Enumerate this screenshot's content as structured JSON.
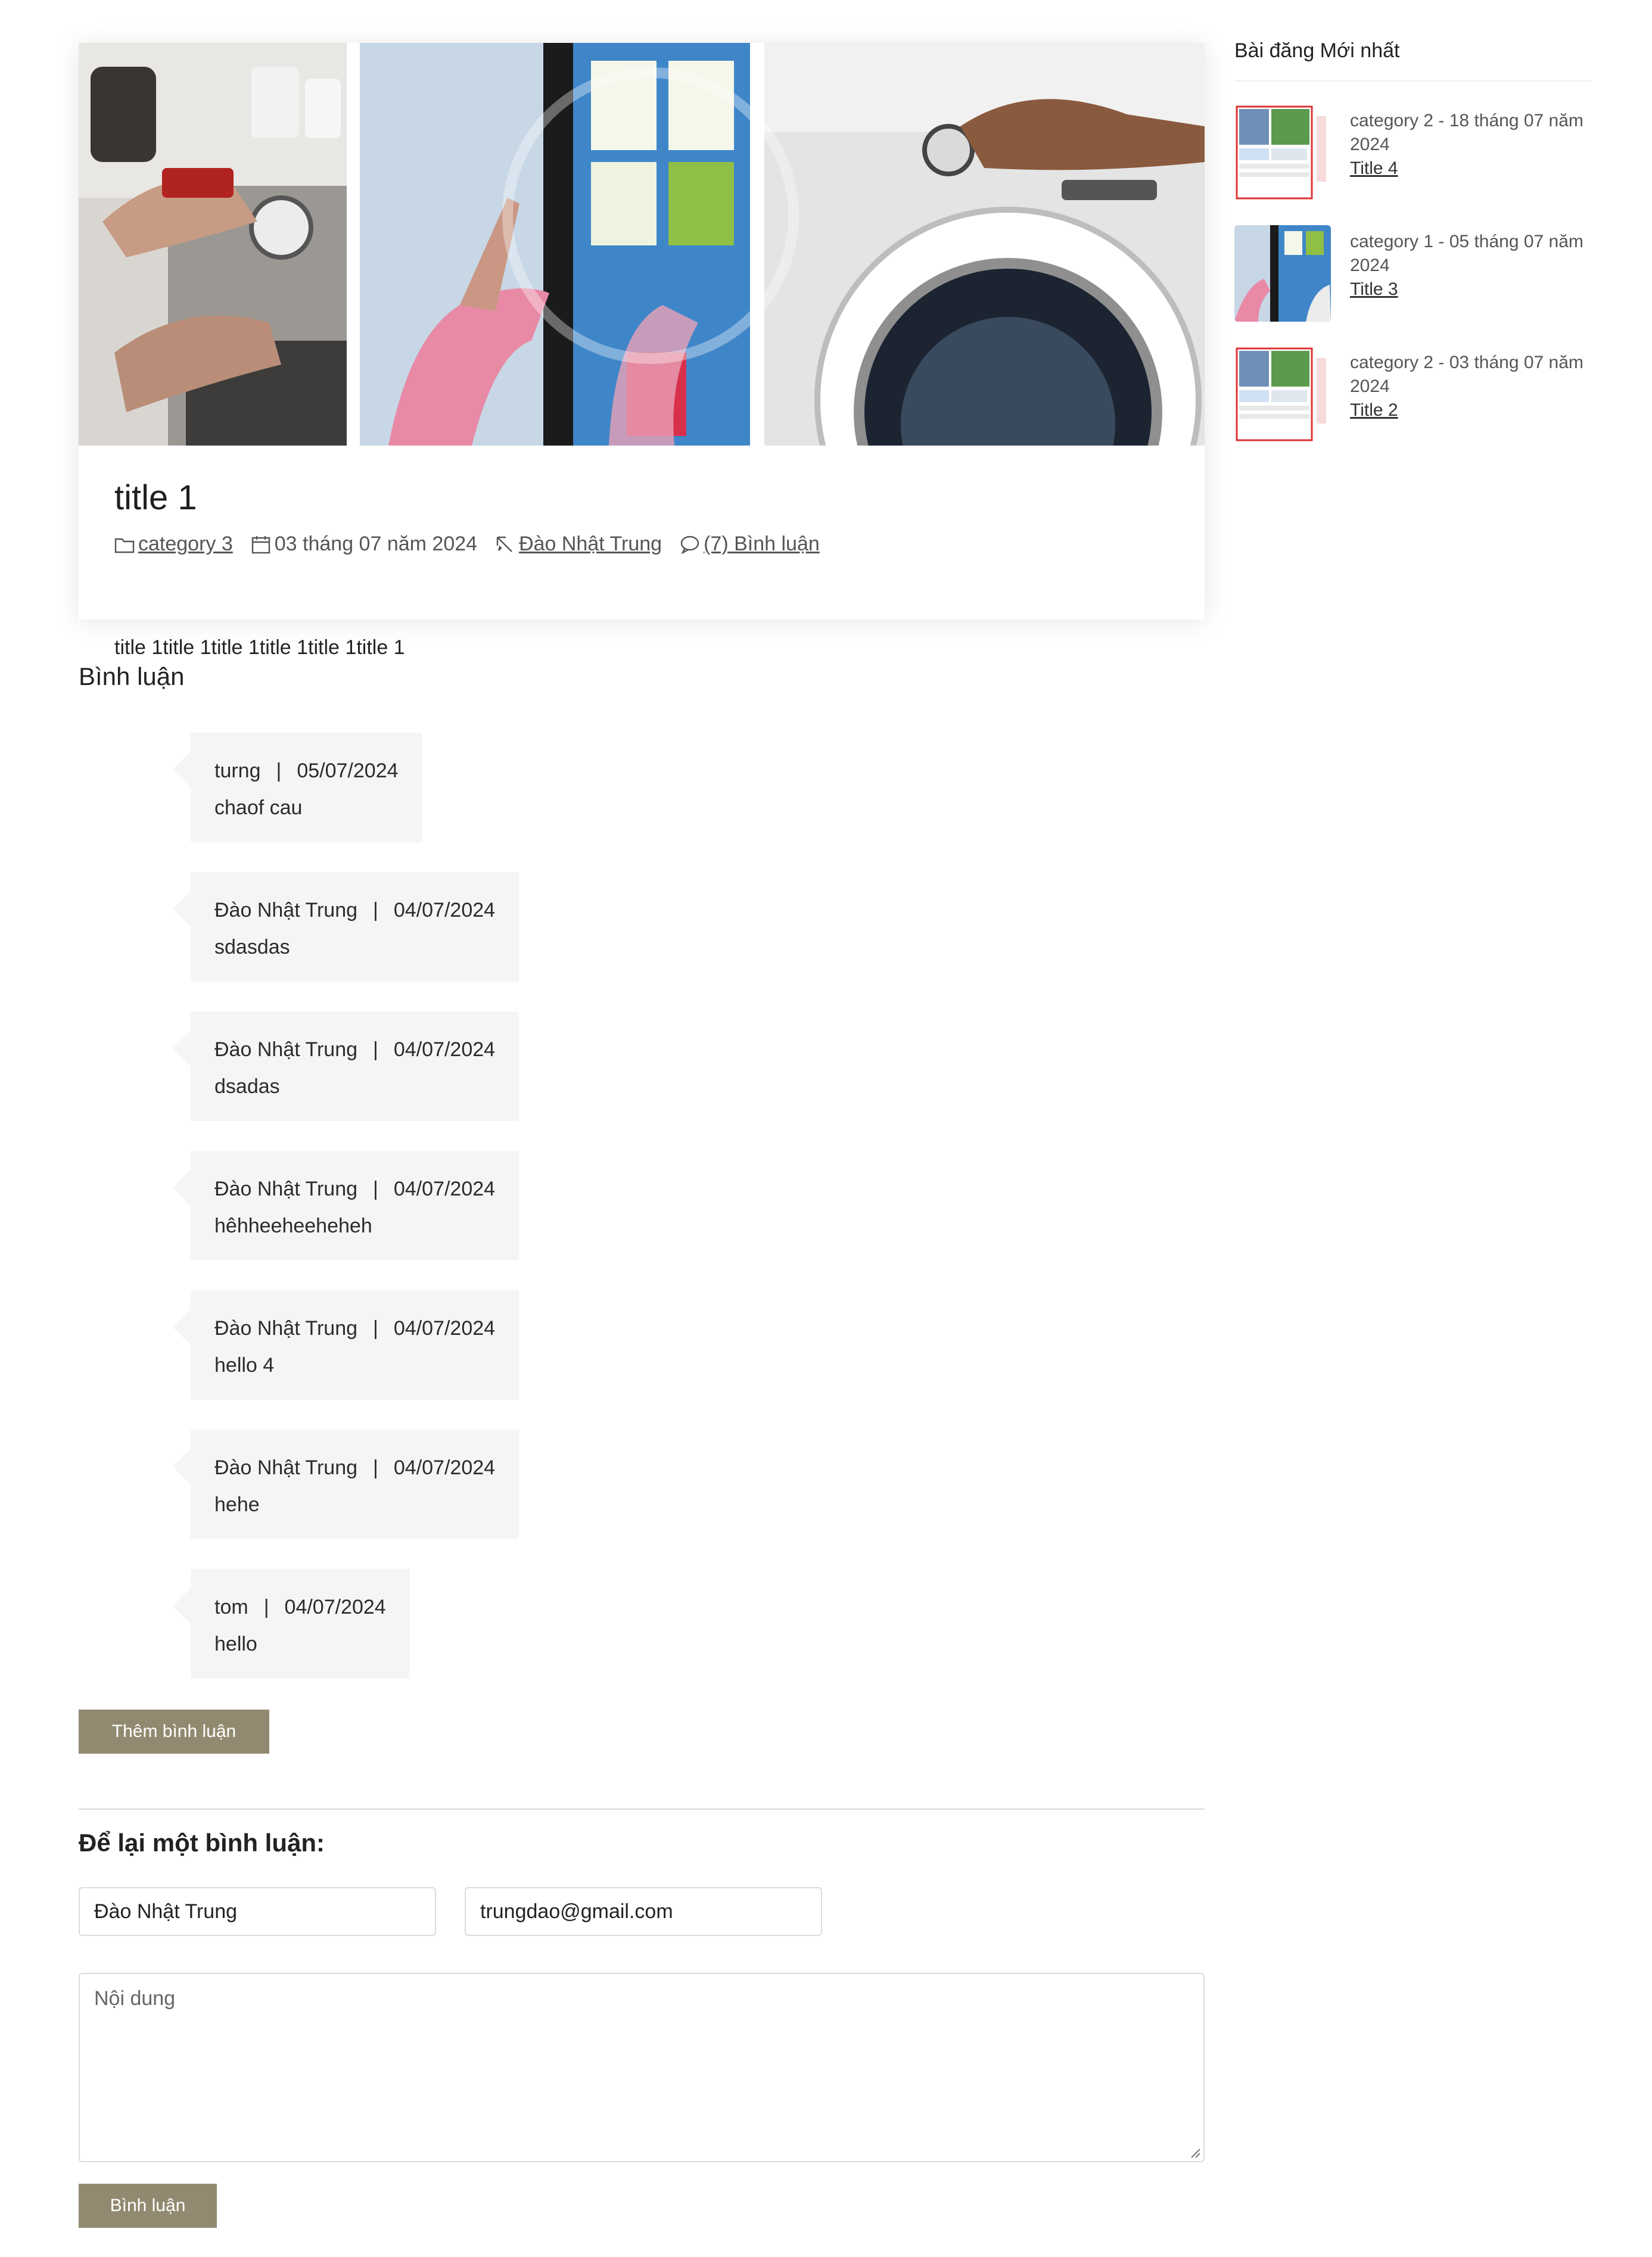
{
  "post": {
    "title": "title 1",
    "category": " category 3",
    "date": "03 tháng 07 năm 2024",
    "author": " Đào Nhật Trung",
    "comments_link": " (7) Bình luận",
    "excerpt": "title 1title 1title 1title 1title 1title 1"
  },
  "sidebar": {
    "heading": "Bài đăng Mới nhất",
    "recent": [
      {
        "meta": "category 2 - 18 tháng 07 năm 2024",
        "title": "Title 4"
      },
      {
        "meta": "category 1 - 05 tháng 07 năm 2024",
        "title": "Title 3"
      },
      {
        "meta": "category 2 - 03 tháng 07 năm 2024",
        "title": "Title 2"
      }
    ]
  },
  "comments": {
    "heading": "Bình luận",
    "items": [
      {
        "author": "turng",
        "date": "05/07/2024",
        "text": "chaof cau"
      },
      {
        "author": "Đào Nhật Trung",
        "date": "04/07/2024",
        "text": "sdasdas"
      },
      {
        "author": "Đào Nhật Trung",
        "date": "04/07/2024",
        "text": "dsadas"
      },
      {
        "author": "Đào Nhật Trung",
        "date": "04/07/2024",
        "text": "hêhheeheeheheh"
      },
      {
        "author": "Đào Nhật Trung",
        "date": "04/07/2024",
        "text": "hello 4"
      },
      {
        "author": "Đào Nhật Trung",
        "date": "04/07/2024",
        "text": "hehe"
      },
      {
        "author": "tom",
        "date": "04/07/2024",
        "text": "hello"
      }
    ],
    "separator": "|",
    "add_button": "Thêm bình luận"
  },
  "form": {
    "heading": "Để lại một bình luận:",
    "name_value": "Đào Nhật Trung",
    "email_value": "trungdao@gmail.com",
    "content_placeholder": "Nội dung",
    "submit_label": "Bình luận"
  },
  "colors": {
    "button": "#928a70",
    "comment_bg": "#f5f5f5",
    "border": "#dcdcdc"
  }
}
